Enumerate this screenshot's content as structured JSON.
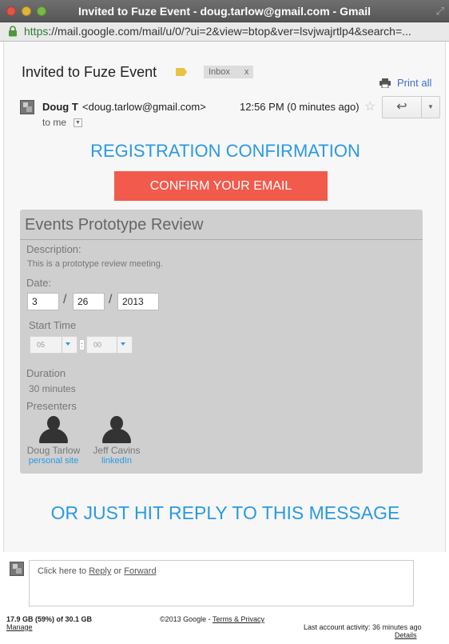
{
  "window": {
    "title": "Invited to Fuze Event - doug.tarlow@gmail.com - Gmail",
    "url_scheme": "https",
    "url_rest": "://mail.google.com/mail/u/0/?ui=2&view=btop&ver=lsvjwajrtlp4&search=..."
  },
  "message": {
    "subject": "Invited to Fuze Event",
    "label": "Inbox",
    "label_close": "x",
    "print_all": "Print all",
    "sender_name": "Doug T",
    "sender_email": "<doug.tarlow@gmail.com>",
    "to": "to me",
    "time": "12:56 PM (0 minutes ago)"
  },
  "body": {
    "heading": "REGISTRATION CONFIRMATION",
    "confirm_button": "CONFIRM YOUR EMAIL",
    "event": {
      "title": "Events Prototype Review",
      "description_label": "Description:",
      "description": "This is a prototype review meeting.",
      "date_label": "Date:",
      "month": "3",
      "day": "26",
      "year": "2013",
      "date_separator": "/",
      "start_time_label": "Start Time",
      "hour": "05",
      "minute": "00",
      "time_separator": ":",
      "duration_label": "Duration",
      "duration": "30 minutes",
      "presenters_label": "Presenters",
      "presenters": [
        {
          "name": "Doug Tarlow",
          "link": "personal site"
        },
        {
          "name": "Jeff Cavins",
          "link": "linkedIn"
        }
      ]
    },
    "reply_note": "OR JUST HIT REPLY TO THIS MESSAGE"
  },
  "reply": {
    "prefix": "Click here to ",
    "reply": "Reply",
    "or": " or ",
    "forward": "Forward"
  },
  "footer": {
    "storage": "17.9 GB (59%) of 30.1 GB",
    "manage": "Manage",
    "copyright": "©2013 Google - ",
    "terms": "Terms & Privacy",
    "activity": "Last account activity: 36 minutes ago",
    "details": "Details"
  },
  "colors": {
    "accent_blue": "#2a9ae0",
    "confirm_red": "#f25a4c",
    "label_yellow": "#e9c341"
  }
}
